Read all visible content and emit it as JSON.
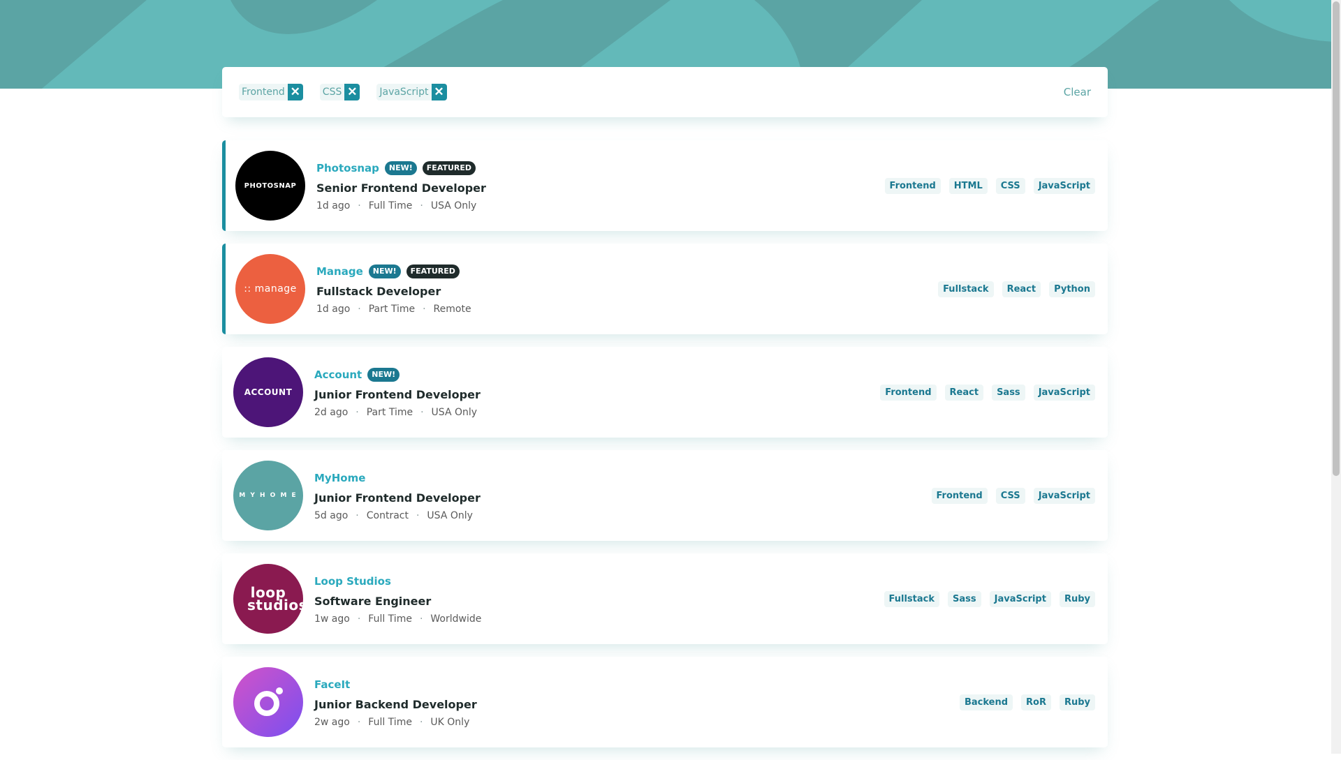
{
  "filters": {
    "tags": [
      "Frontend",
      "CSS",
      "JavaScript"
    ],
    "clear_label": "Clear"
  },
  "jobs": [
    {
      "company": "Photosnap",
      "logo_text": "PHOTOSNAP",
      "logo_color": "#000000",
      "new_label": "NEW!",
      "featured_label": "FEATURED",
      "position": "Senior Frontend Developer",
      "posted": "1d ago",
      "contract": "Full Time",
      "location": "USA Only",
      "tags": [
        "Frontend",
        "HTML",
        "CSS",
        "JavaScript"
      ]
    },
    {
      "company": "Manage",
      "logo_text": ":: manage",
      "logo_color": "#ec6040",
      "new_label": "NEW!",
      "featured_label": "FEATURED",
      "position": "Fullstack Developer",
      "posted": "1d ago",
      "contract": "Part Time",
      "location": "Remote",
      "tags": [
        "Fullstack",
        "React",
        "Python"
      ]
    },
    {
      "company": "Account",
      "logo_text": "ACCOUNT",
      "logo_color": "#4d1578",
      "new_label": "NEW!",
      "position": "Junior Frontend Developer",
      "posted": "2d ago",
      "contract": "Part Time",
      "location": "USA Only",
      "tags": [
        "Frontend",
        "React",
        "Sass",
        "JavaScript"
      ]
    },
    {
      "company": "MyHome",
      "logo_text": "M Y H O M E",
      "logo_color": "#5ba4a4",
      "position": "Junior Frontend Developer",
      "posted": "5d ago",
      "contract": "Contract",
      "location": "USA Only",
      "tags": [
        "Frontend",
        "CSS",
        "JavaScript"
      ]
    },
    {
      "company": "Loop Studios",
      "logo_text": "loop studios",
      "logo_color": "#8a1a50",
      "position": "Software Engineer",
      "posted": "1w ago",
      "contract": "Full Time",
      "location": "Worldwide",
      "tags": [
        "Fullstack",
        "Sass",
        "JavaScript",
        "Ruby"
      ]
    },
    {
      "company": "FaceIt",
      "logo_color": "#b04fd8",
      "position": "Junior Backend Developer",
      "posted": "2w ago",
      "contract": "Full Time",
      "location": "UK Only",
      "tags": [
        "Backend",
        "RoR",
        "Ruby"
      ]
    }
  ]
}
